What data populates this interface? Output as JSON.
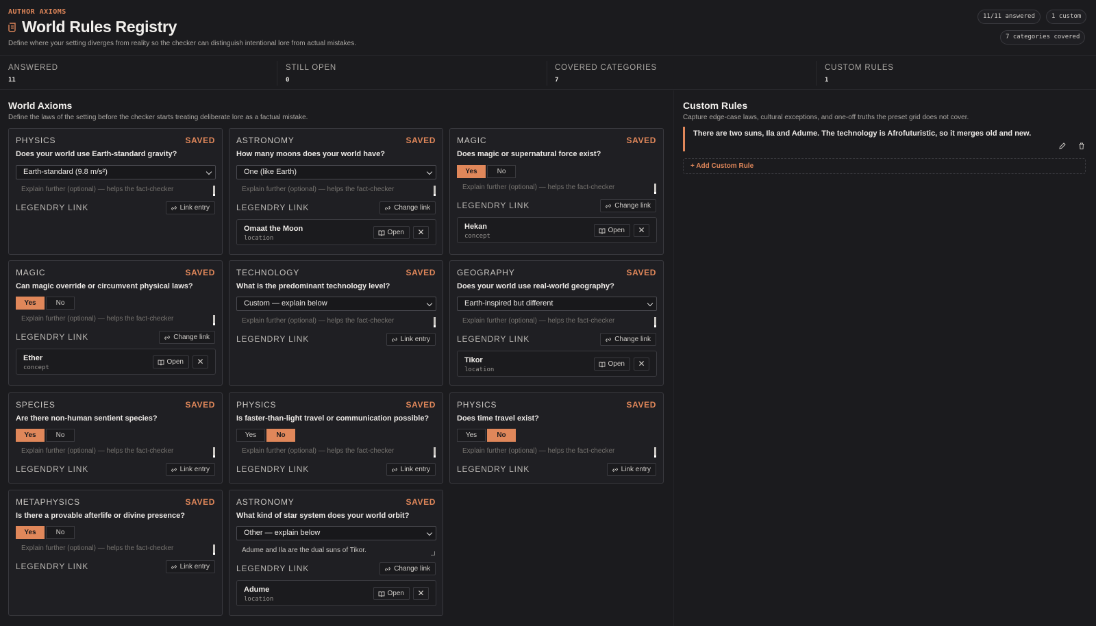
{
  "header": {
    "eyebrow": "AUTHOR AXIOMS",
    "title": "World Rules Registry",
    "subtitle": "Define where your setting diverges from reality so the checker can distinguish intentional lore from actual mistakes.",
    "pill_answered": "11/11 answered",
    "pill_custom": "1 custom",
    "pill_categories": "7 categories covered"
  },
  "stats": [
    {
      "label": "ANSWERED",
      "value": "11"
    },
    {
      "label": "STILL OPEN",
      "value": "0"
    },
    {
      "label": "COVERED CATEGORIES",
      "value": "7"
    },
    {
      "label": "CUSTOM RULES",
      "value": "1"
    }
  ],
  "axioms": {
    "title": "World Axioms",
    "subtitle": "Define the laws of the setting before the checker starts treating deliberate lore as a factual mistake."
  },
  "common": {
    "saved": "SAVED",
    "explain_placeholder": "Explain further (optional) — helps the fact-checker",
    "legendry_link": "LEGENDRY LINK",
    "link_entry": "Link entry",
    "change_link": "Change link",
    "open": "Open",
    "yes": "Yes",
    "no": "No",
    "close_glyph": "✕"
  },
  "cards": [
    {
      "category": "PHYSICS",
      "question": "Does your world use Earth-standard gravity?",
      "select": "Earth-standard (9.8 m/s²)"
    },
    {
      "category": "ASTRONOMY",
      "question": "How many moons does your world have?",
      "select": "One (like Earth)",
      "entry": {
        "name": "Omaat the Moon",
        "type": "location"
      }
    },
    {
      "category": "MAGIC",
      "question": "Does magic or supernatural force exist?",
      "toggle": "yes",
      "entry": {
        "name": "Hekan",
        "type": "concept"
      }
    },
    {
      "category": "MAGIC",
      "question": "Can magic override or circumvent physical laws?",
      "toggle": "yes",
      "entry": {
        "name": "Ether",
        "type": "concept"
      }
    },
    {
      "category": "TECHNOLOGY",
      "question": "What is the predominant technology level?",
      "select": "Custom — explain below"
    },
    {
      "category": "GEOGRAPHY",
      "question": "Does your world use real-world geography?",
      "select": "Earth-inspired but different",
      "entry": {
        "name": "Tikor",
        "type": "location"
      }
    },
    {
      "category": "SPECIES",
      "question": "Are there non-human sentient species?",
      "toggle": "yes"
    },
    {
      "category": "PHYSICS",
      "question": "Is faster-than-light travel or communication possible?",
      "toggle": "no"
    },
    {
      "category": "PHYSICS",
      "question": "Does time travel exist?",
      "toggle": "no"
    },
    {
      "category": "METAPHYSICS",
      "question": "Is there a provable afterlife or divine presence?",
      "toggle": "yes"
    },
    {
      "category": "ASTRONOMY",
      "question": "What kind of star system does your world orbit?",
      "select": "Other — explain below",
      "explain_value": "Adume and Ila are the dual suns of Tikor.",
      "entry": {
        "name": "Adume",
        "type": "location"
      }
    }
  ],
  "custom": {
    "title": "Custom Rules",
    "subtitle": "Capture edge-case laws, cultural exceptions, and one-off truths the preset grid does not cover.",
    "rule_text": "There are two suns, Ila and Adume. The technology is Afrofuturistic, so it merges old and new.",
    "add_label": "Add Custom Rule"
  },
  "colors": {
    "accent": "#e0875a",
    "background": "#1b1b1e",
    "card": "#1f1f23"
  }
}
